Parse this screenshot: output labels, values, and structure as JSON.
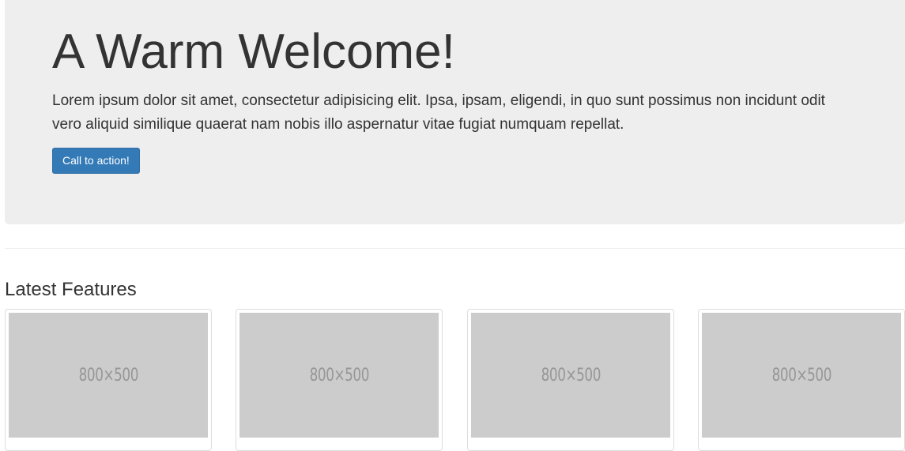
{
  "jumbotron": {
    "title": "A Warm Welcome!",
    "text": "Lorem ipsum dolor sit amet, consectetur adipisicing elit. Ipsa, ipsam, eligendi, in quo sunt possimus non incidunt odit vero aliquid similique quaerat nam nobis illo aspernatur vitae fugiat numquam repellat.",
    "button_label": "Call to action!"
  },
  "features": {
    "title": "Latest Features",
    "items": [
      {
        "image_label": "800×500"
      },
      {
        "image_label": "800×500"
      },
      {
        "image_label": "800×500"
      },
      {
        "image_label": "800×500"
      }
    ]
  },
  "colors": {
    "primary_button": "#337ab7",
    "jumbotron_bg": "#eeeeee",
    "placeholder_bg": "#cccccc"
  }
}
